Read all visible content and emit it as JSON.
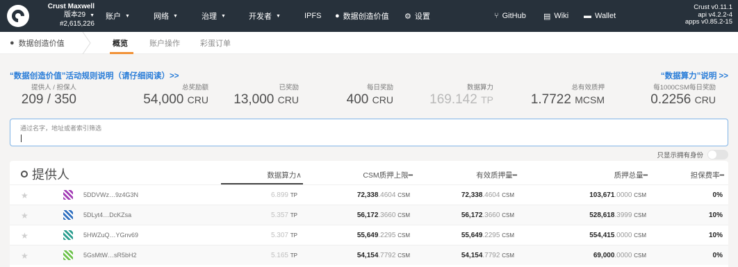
{
  "topbar": {
    "chain_name": "Crust Maxwell",
    "version": "版本29",
    "block": "#2,615,226",
    "nav": [
      {
        "label": "账户",
        "dropdown": true
      },
      {
        "label": "网络",
        "dropdown": true
      },
      {
        "label": "治理",
        "dropdown": true
      },
      {
        "label": "开发者",
        "dropdown": true
      },
      {
        "label": "IPFS",
        "dropdown": false
      },
      {
        "label": "数据创造价值",
        "icon": "drop-icon"
      },
      {
        "label": "设置",
        "icon": "gear-icon"
      }
    ],
    "links": [
      {
        "label": "GitHub",
        "icon": "github-icon"
      },
      {
        "label": "Wiki",
        "icon": "book-icon"
      },
      {
        "label": "Wallet",
        "icon": "wallet-icon"
      }
    ],
    "app_info": [
      "Crust v0.11.1",
      "api v4.2.2-4",
      "apps v0.85.2-15"
    ]
  },
  "subnav": {
    "section": "数据创造价值",
    "tabs": [
      "概览",
      "账户操作",
      "彩蛋订单"
    ],
    "active_tab": "概览"
  },
  "summary": {
    "left_link": "“数据创造价值”活动规则说明（请仔细阅读）>>",
    "right_link": "“数据算力”说明 >>",
    "stats": [
      {
        "label": "提供人 / 担保人",
        "value": "209 / 350",
        "unit": ""
      },
      {
        "label": "总奖励额",
        "value": "54,000",
        "unit": "CRU"
      },
      {
        "label": "已奖励",
        "value": "13,000",
        "unit": "CRU"
      },
      {
        "label": "每日奖励",
        "value": "400",
        "unit": "CRU"
      },
      {
        "label": "数据算力",
        "value": "169.142",
        "unit": "TP"
      },
      {
        "label": "总有效质押",
        "value": "1.7722",
        "unit": "MCSM"
      },
      {
        "label": "每1000CSM每日奖励",
        "value": "0.2256",
        "unit": "CRU"
      }
    ]
  },
  "filter": {
    "placeholder": "通过名字，地址或者索引筛选",
    "value": ""
  },
  "toggle_label": "只显示拥有身份",
  "table": {
    "title": "提供人",
    "headers": [
      "数据算力∧",
      "CSM质押上限━",
      "有效质押量━",
      "质押总量━",
      "担保费率━"
    ],
    "rows": [
      {
        "addr": "5DDVWz…9z4G3N",
        "power": "6.899",
        "limit_int": "72,338",
        "limit_frac": ".4604",
        "eff_int": "72,338",
        "eff_frac": ".4604",
        "total_int": "103,671",
        "total_frac": ".0000",
        "fee": "0%",
        "color": "#a23bb5"
      },
      {
        "addr": "5DLyt4…DcKZsa",
        "power": "5.357",
        "limit_int": "56,172",
        "limit_frac": ".3660",
        "eff_int": "56,172",
        "eff_frac": ".3660",
        "total_int": "528,618",
        "total_frac": ".3999",
        "fee": "10%",
        "color": "#2f6fbf"
      },
      {
        "addr": "5HWZuQ…YGnv69",
        "power": "5.307",
        "limit_int": "55,649",
        "limit_frac": ".2295",
        "eff_int": "55,649",
        "eff_frac": ".2295",
        "total_int": "554,415",
        "total_frac": ".0000",
        "fee": "10%",
        "color": "#2a9d8f"
      },
      {
        "addr": "5GsMtW…sR5bH2",
        "power": "5.165",
        "limit_int": "54,154",
        "limit_frac": ".7792",
        "eff_int": "54,154",
        "eff_frac": ".7792",
        "total_int": "69,000",
        "total_frac": ".0000",
        "fee": "0%",
        "color": "#6cc24a"
      }
    ],
    "units": {
      "power": "TP",
      "csm": "CSM"
    }
  }
}
